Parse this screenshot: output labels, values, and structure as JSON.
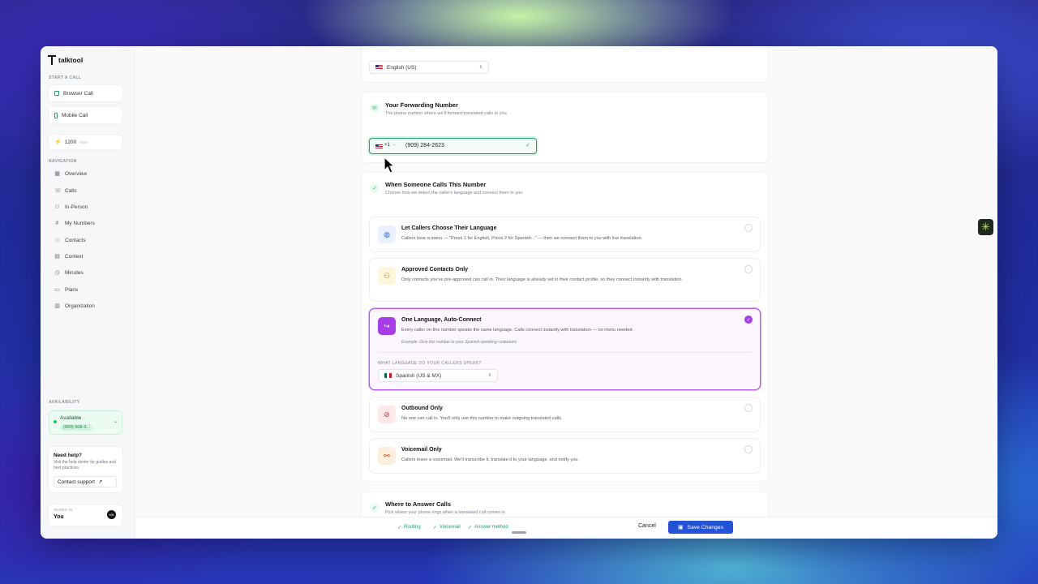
{
  "app": {
    "name": "talktool"
  },
  "sidebar": {
    "start_call_label": "START A CALL",
    "browser_call": "Browser Call",
    "mobile_call": "Mobile Call",
    "credits": "1200",
    "navigation_label": "NAVIGATION",
    "nav": [
      {
        "label": "Overview",
        "icon": "grid-icon"
      },
      {
        "label": "Calls",
        "icon": "phone-icon"
      },
      {
        "label": "In-Person",
        "icon": "users-icon"
      },
      {
        "label": "My Numbers",
        "icon": "hash-icon"
      },
      {
        "label": "Contacts",
        "icon": "contact-icon"
      },
      {
        "label": "Context",
        "icon": "document-icon"
      },
      {
        "label": "Minutes",
        "icon": "timer-icon"
      },
      {
        "label": "Plans",
        "icon": "card-icon"
      },
      {
        "label": "Organization",
        "icon": "building-icon"
      }
    ],
    "availability_label": "AVAILABILITY",
    "availability_status": "Available",
    "availability_number": "(909) 508-3...",
    "help_title": "Need help?",
    "help_desc": "Visit the help center for guides and best practices.",
    "contact_support": "Contact support",
    "signed_in_label": "SIGNED IN",
    "user_name": "You",
    "user_initials": "MB"
  },
  "main": {
    "language_select": "English (US)",
    "forwarding": {
      "title": "Your Forwarding Number",
      "subtitle": "The phone number where we'll forward translated calls to you",
      "country_code": "+1",
      "number": "(909) 284-2623"
    },
    "routing": {
      "title": "When Someone Calls This Number",
      "subtitle": "Choose how we detect the caller's language and connect them to you",
      "options": [
        {
          "title": "Let Callers Choose Their Language",
          "desc": "Callers hear a menu — \"Press 1 for English, Press 2 for Spanish...\" — then we connect them to you with live translation.",
          "selected": false
        },
        {
          "title": "Approved Contacts Only",
          "desc": "Only contacts you've pre-approved can call in. Their language is already set in their contact profile, so they connect instantly with translation.",
          "selected": false
        },
        {
          "title": "One Language, Auto-Connect",
          "desc": "Every caller on this number speaks the same language. Calls connect instantly with translation — no menu needed.",
          "example": "Example: Give this number to your Spanish-speaking customers",
          "language_question": "WHAT LANGUAGE DO YOUR CALLERS SPEAK?",
          "language": "Spanish (US & MX)",
          "selected": true
        },
        {
          "title": "Outbound Only",
          "desc": "No one can call in. You'll only use this number to make outgoing translated calls.",
          "selected": false
        },
        {
          "title": "Voicemail Only",
          "desc": "Callers leave a voicemail. We'll transcribe it, translate it to your language, and notify you.",
          "selected": false
        }
      ]
    },
    "answer": {
      "title": "Where to Answer Calls",
      "subtitle": "Pick where your phone rings when a translated call comes in"
    }
  },
  "footer": {
    "steps": [
      "Routing",
      "Voicemail",
      "Answer method"
    ],
    "cancel": "Cancel",
    "save": "Save Changes"
  },
  "colors": {
    "accent": "#22a06b",
    "selected": "#a63de6",
    "primary": "#2453d6"
  }
}
